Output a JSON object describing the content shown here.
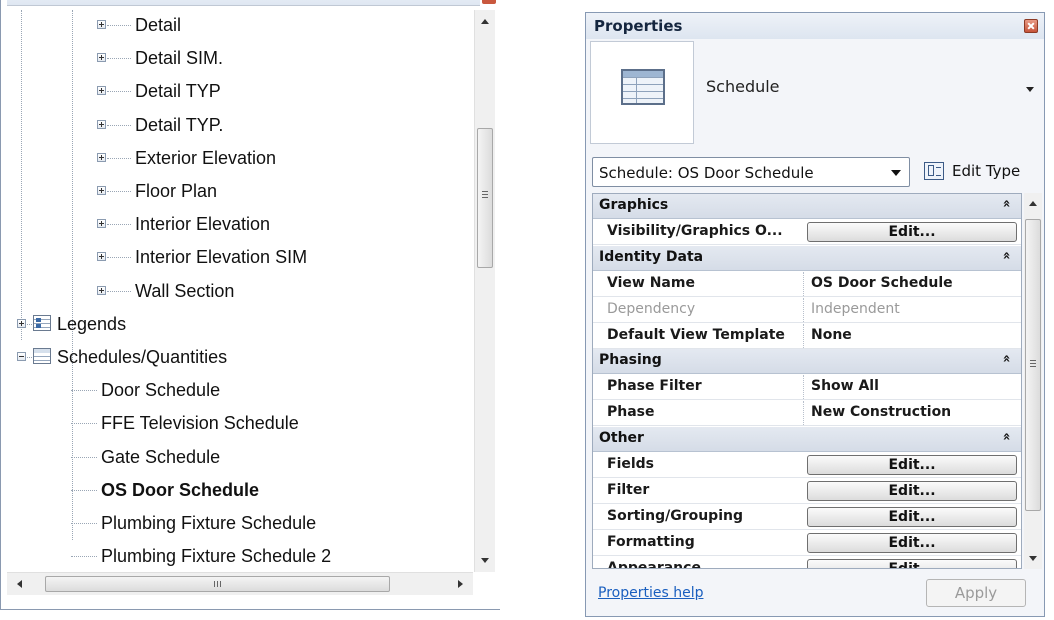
{
  "browser": {
    "tree": [
      {
        "label": "Detail",
        "level": 2,
        "expander": "plus",
        "bold": false
      },
      {
        "label": "Detail SIM.",
        "level": 2,
        "expander": "plus",
        "bold": false
      },
      {
        "label": "Detail TYP",
        "level": 2,
        "expander": "plus",
        "bold": false
      },
      {
        "label": "Detail TYP.",
        "level": 2,
        "expander": "plus",
        "bold": false
      },
      {
        "label": "Exterior Elevation",
        "level": 2,
        "expander": "plus",
        "bold": false
      },
      {
        "label": "Floor Plan",
        "level": 2,
        "expander": "plus",
        "bold": false
      },
      {
        "label": "Interior Elevation",
        "level": 2,
        "expander": "plus",
        "bold": false
      },
      {
        "label": "Interior Elevation SIM",
        "level": 2,
        "expander": "plus",
        "bold": false
      },
      {
        "label": "Wall Section",
        "level": 2,
        "expander": "plus",
        "bold": false
      },
      {
        "label": "Legends",
        "level": 0,
        "expander": "plus",
        "icon": "legend-icon",
        "bold": false
      },
      {
        "label": "Schedules/Quantities",
        "level": 0,
        "expander": "minus",
        "icon": "schedule-icon",
        "bold": false
      },
      {
        "label": "Door Schedule",
        "level": 1,
        "bold": false
      },
      {
        "label": "FFE Television Schedule",
        "level": 1,
        "bold": false
      },
      {
        "label": "Gate Schedule",
        "level": 1,
        "bold": false
      },
      {
        "label": "OS Door Schedule",
        "level": 1,
        "bold": true
      },
      {
        "label": "Plumbing Fixture Schedule",
        "level": 1,
        "bold": false
      },
      {
        "label": "Plumbing Fixture Schedule 2",
        "level": 1,
        "bold": false
      }
    ]
  },
  "properties": {
    "title": "Properties",
    "type_selector": {
      "name": "Schedule",
      "icon": "schedule-icon"
    },
    "instance_selector": "Schedule: OS Door Schedule",
    "edit_type_label": "Edit Type",
    "groups": [
      {
        "name": "Graphics",
        "rows": [
          {
            "name": "Visibility/Graphics O...",
            "button": "Edit..."
          }
        ]
      },
      {
        "name": "Identity Data",
        "rows": [
          {
            "name": "View Name",
            "value": "OS Door Schedule"
          },
          {
            "name": "Dependency",
            "value": "Independent",
            "disabled": true
          },
          {
            "name": "Default View Template",
            "value": "None"
          }
        ]
      },
      {
        "name": "Phasing",
        "rows": [
          {
            "name": "Phase Filter",
            "value": "Show All"
          },
          {
            "name": "Phase",
            "value": "New Construction"
          }
        ]
      },
      {
        "name": "Other",
        "rows": [
          {
            "name": "Fields",
            "button": "Edit..."
          },
          {
            "name": "Filter",
            "button": "Edit..."
          },
          {
            "name": "Sorting/Grouping",
            "button": "Edit..."
          },
          {
            "name": "Formatting",
            "button": "Edit..."
          },
          {
            "name": "Appearance",
            "button": "Edit..."
          }
        ]
      }
    ],
    "collapse_glyph": "»",
    "help_link": "Properties help",
    "apply_label": "Apply"
  },
  "colors": {
    "group_header_bg": "#dbe1ea",
    "link": "#1a5fbf",
    "close_red": "#c6543a"
  }
}
